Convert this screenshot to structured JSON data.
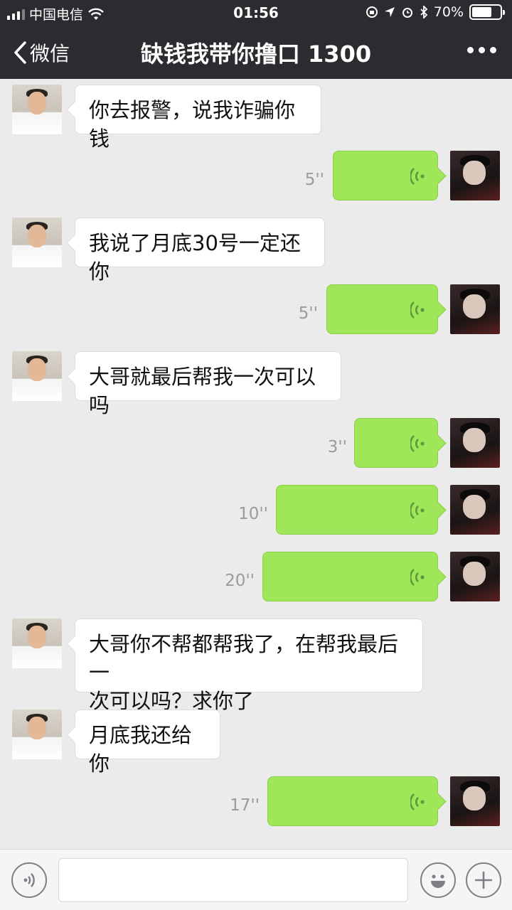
{
  "status_bar": {
    "carrier": "中国电信",
    "time": "01:56",
    "battery": "70%",
    "battery_level": 0.7
  },
  "nav": {
    "back_label": "微信",
    "title": "缺钱我带你撸口 1300"
  },
  "messages": [
    {
      "from": "other",
      "type": "text",
      "text": "你去报警，说我诈骗你钱"
    },
    {
      "from": "self",
      "type": "voice",
      "duration": "5''"
    },
    {
      "from": "other",
      "type": "text",
      "text": "我说了月底30号一定还你"
    },
    {
      "from": "self",
      "type": "voice",
      "duration": "5''"
    },
    {
      "from": "other",
      "type": "text",
      "text": "大哥就最后帮我一次可以吗"
    },
    {
      "from": "self",
      "type": "voice",
      "duration": "3''"
    },
    {
      "from": "self",
      "type": "voice",
      "duration": "10''"
    },
    {
      "from": "self",
      "type": "voice",
      "duration": "20''"
    },
    {
      "from": "other",
      "type": "text",
      "text_lines": [
        "大哥你不帮都帮我了，在帮我最后一",
        "次可以吗？求你了"
      ]
    },
    {
      "from": "other",
      "type": "text",
      "text": "月底我还给你"
    },
    {
      "from": "self",
      "type": "voice",
      "duration": "17''"
    }
  ],
  "colors": {
    "nav_bg": "#2b2c30",
    "chat_bg": "#ebebeb",
    "self_bubble": "#9fe658",
    "other_bubble": "#ffffff",
    "voice_icon": "#5c9a3a"
  },
  "icons": {
    "back": "chevron-left-icon",
    "more": "more-dots-icon",
    "voice_wave": "voice-wave-icon",
    "voice_mode": "voice-mode-icon",
    "emoji": "emoji-icon",
    "add": "plus-icon"
  }
}
